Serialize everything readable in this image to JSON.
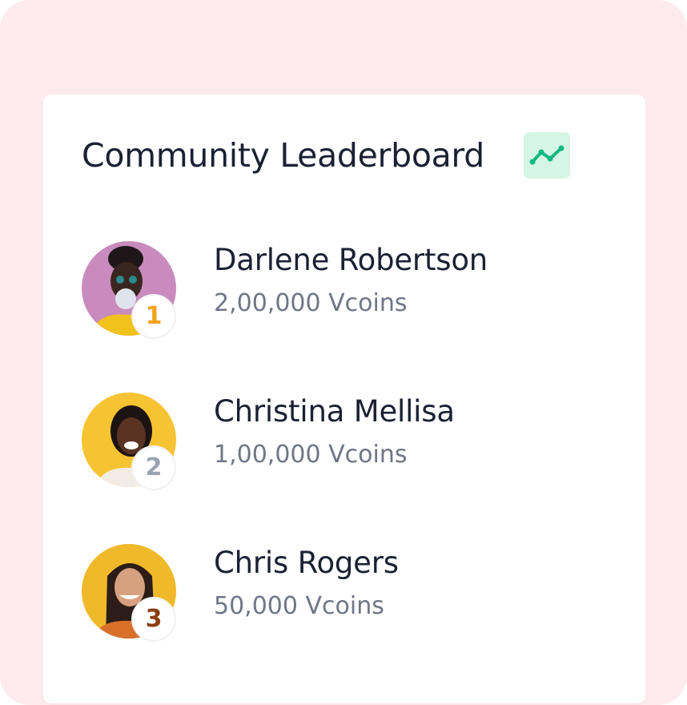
{
  "leaderboard": {
    "title": "Community Leaderboard",
    "icon": "trending-chart-icon",
    "colors": {
      "background": "#fdebef",
      "card": "#ffffff",
      "accent_green": "#10b981",
      "badge_green_bg": "#d5f5e6",
      "gold": "#f5a21b",
      "silver": "#9aa3b2",
      "bronze": "#8a3d12"
    },
    "entries": [
      {
        "rank": "1",
        "name": "Darlene Robertson",
        "coins": "2,00,000 Vcoins",
        "rank_color": "#f5a21b"
      },
      {
        "rank": "2",
        "name": "Christina Mellisa",
        "coins": "1,00,000 Vcoins",
        "rank_color": "#9aa3b2"
      },
      {
        "rank": "3",
        "name": "Chris Rogers",
        "coins": "50,000 Vcoins",
        "rank_color": "#8a3d12"
      }
    ]
  }
}
